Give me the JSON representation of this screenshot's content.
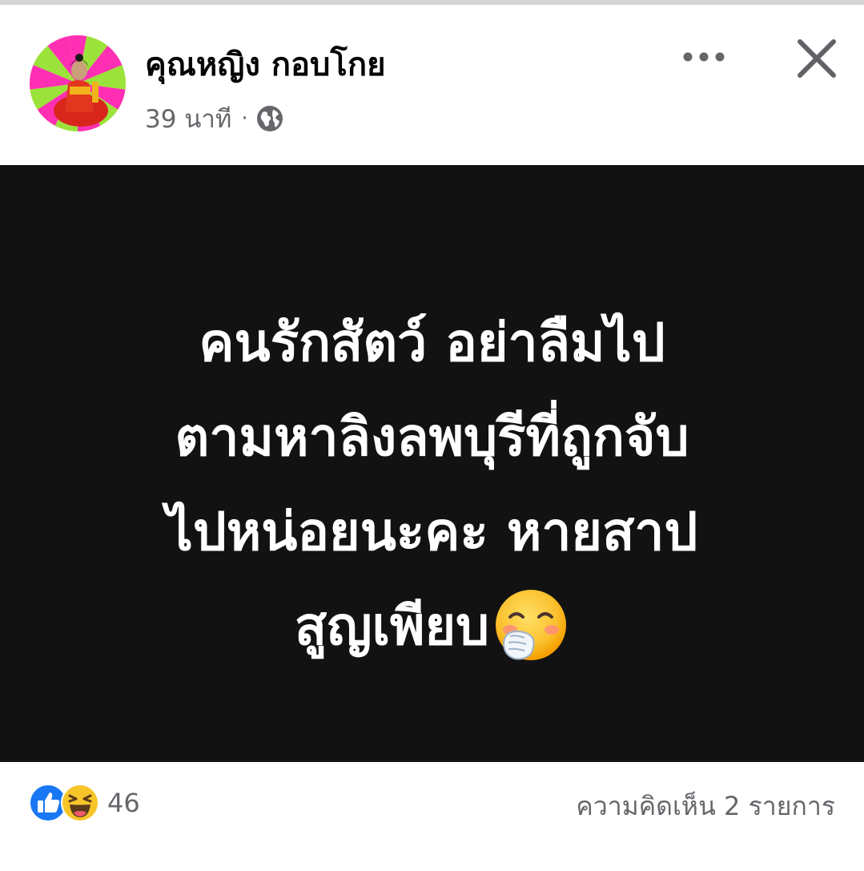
{
  "post": {
    "author": "คุณหญิง กอบโกย",
    "time": "39 นาที",
    "separator": "·",
    "privacy_icon": "globe-icon",
    "text_lines": [
      "คนรักสัตว์ อย่าลืมไป",
      "ตามหาลิงลพบุรีที่ถูกจับ",
      "ไปหน่อยนะคะ หายสาป",
      "สูญเพียบ"
    ],
    "emoji": "face-with-hand-over-mouth",
    "background_color": "#121212",
    "text_color": "#ffffff"
  },
  "actions": {
    "more_icon": "more-dots-icon",
    "close_icon": "close-icon"
  },
  "footer": {
    "reaction_icons": [
      "like-icon",
      "haha-icon"
    ],
    "reaction_count": "46",
    "comments_label": "ความคิดเห็น 2 รายการ"
  },
  "colors": {
    "brand_blue": "#1877f2",
    "secondary_text": "#65676b",
    "primary_text": "#050505"
  }
}
